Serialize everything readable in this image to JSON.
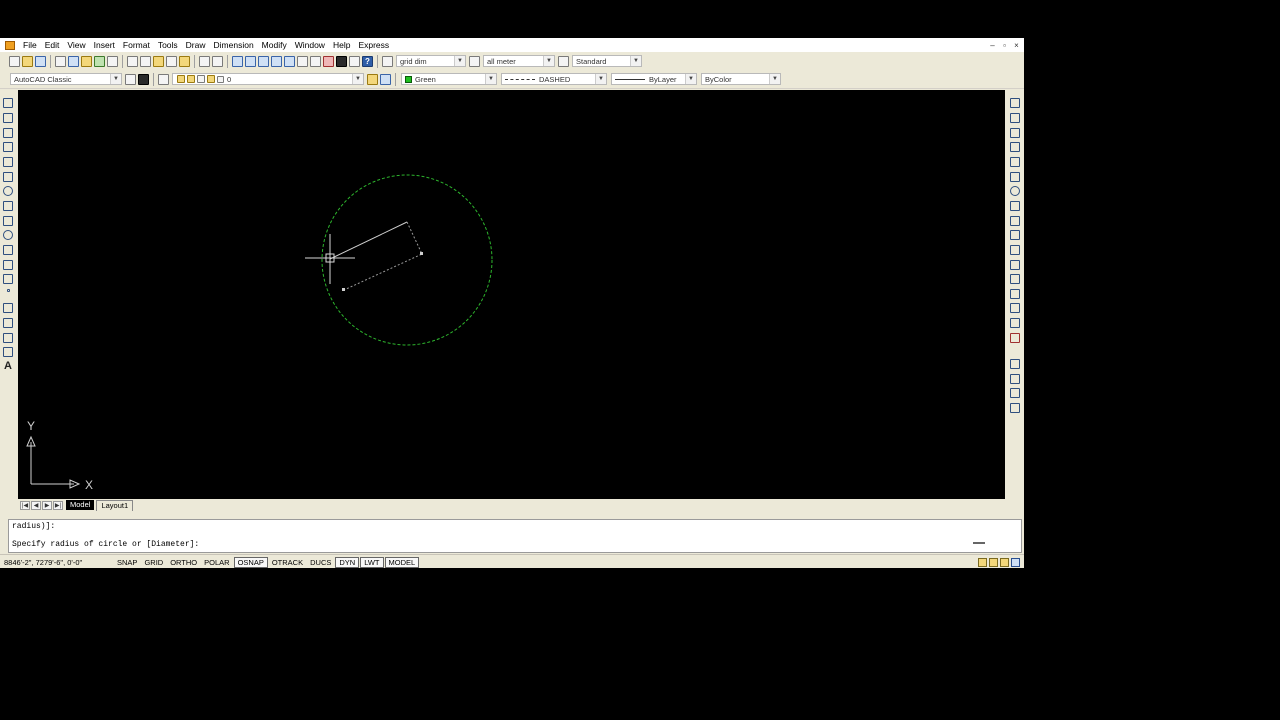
{
  "menu": [
    "File",
    "Edit",
    "View",
    "Insert",
    "Format",
    "Tools",
    "Draw",
    "Dimension",
    "Modify",
    "Window",
    "Help",
    "Express"
  ],
  "window_controls": [
    "–",
    "▫",
    "×"
  ],
  "toolbar": {
    "dimstyle": "grid dim",
    "textstyle": "all meter",
    "tablestyle": "Standard",
    "workspace": "AutoCAD Classic",
    "layer": "0",
    "color": "Green",
    "linetype": "DASHED",
    "lineweight": "ByLayer",
    "plotstyle": "ByColor",
    "help_glyph": "?"
  },
  "layout_tabs": {
    "nav": [
      "|◀",
      "◀",
      "▶",
      "▶|"
    ],
    "tabs": [
      "Model",
      "Layout1"
    ]
  },
  "ucs": {
    "y_label": "Y",
    "x_label": "X"
  },
  "command": {
    "line1": "radius)]:",
    "line2": "Specify radius of circle or [Diameter]:"
  },
  "status": {
    "coords": "8846'-2\", 7279'-6\", 0'-0\"",
    "buttons": [
      {
        "label": "SNAP",
        "on": false
      },
      {
        "label": "GRID",
        "on": false
      },
      {
        "label": "ORTHO",
        "on": false
      },
      {
        "label": "POLAR",
        "on": false
      },
      {
        "label": "OSNAP",
        "on": true
      },
      {
        "label": "OTRACK",
        "on": false
      },
      {
        "label": "DUCS",
        "on": false
      },
      {
        "label": "DYN",
        "on": true
      },
      {
        "label": "LWT",
        "on": true
      },
      {
        "label": "MODEL",
        "on": true
      }
    ]
  },
  "colors": {
    "canvas": "#000000",
    "circle": "#2db52d",
    "crosshair": "#d9d9d9",
    "chrome": "#ece9d8"
  }
}
